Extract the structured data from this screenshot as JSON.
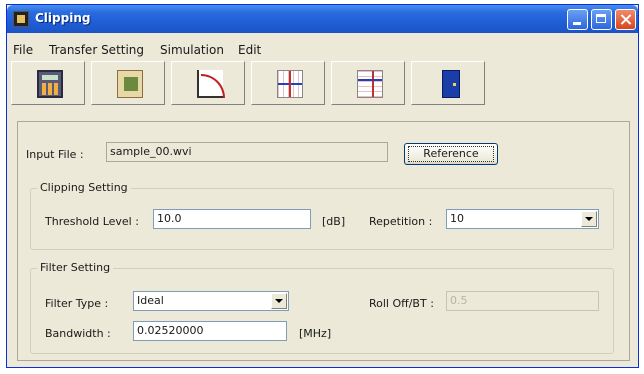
{
  "window": {
    "title": "Clipping"
  },
  "menu": [
    {
      "label": "File"
    },
    {
      "label": "Transfer Setting"
    },
    {
      "label": "Simulation"
    },
    {
      "label": "Edit"
    }
  ],
  "toolbar": {
    "icons": [
      "calculator-icon",
      "import-icon",
      "curve-graph-icon",
      "grid-chart-icon",
      "grid-chart-alt-icon",
      "exit-door-icon"
    ]
  },
  "input_file": {
    "label": "Input File :",
    "value": "sample_00.wvi",
    "button": "Reference"
  },
  "clipping": {
    "title": "Clipping Setting",
    "threshold_label": "Threshold Level :",
    "threshold_value": "10.0",
    "threshold_unit": "[dB]",
    "repetition_label": "Repetition :",
    "repetition_value": "10"
  },
  "filter": {
    "title": "Filter Setting",
    "type_label": "Filter Type :",
    "type_value": "Ideal",
    "rolloff_label": "Roll Off/BT :",
    "rolloff_value": "0.5",
    "bandwidth_label": "Bandwidth :",
    "bandwidth_value": "0.02520000",
    "bandwidth_unit": "[MHz]"
  }
}
